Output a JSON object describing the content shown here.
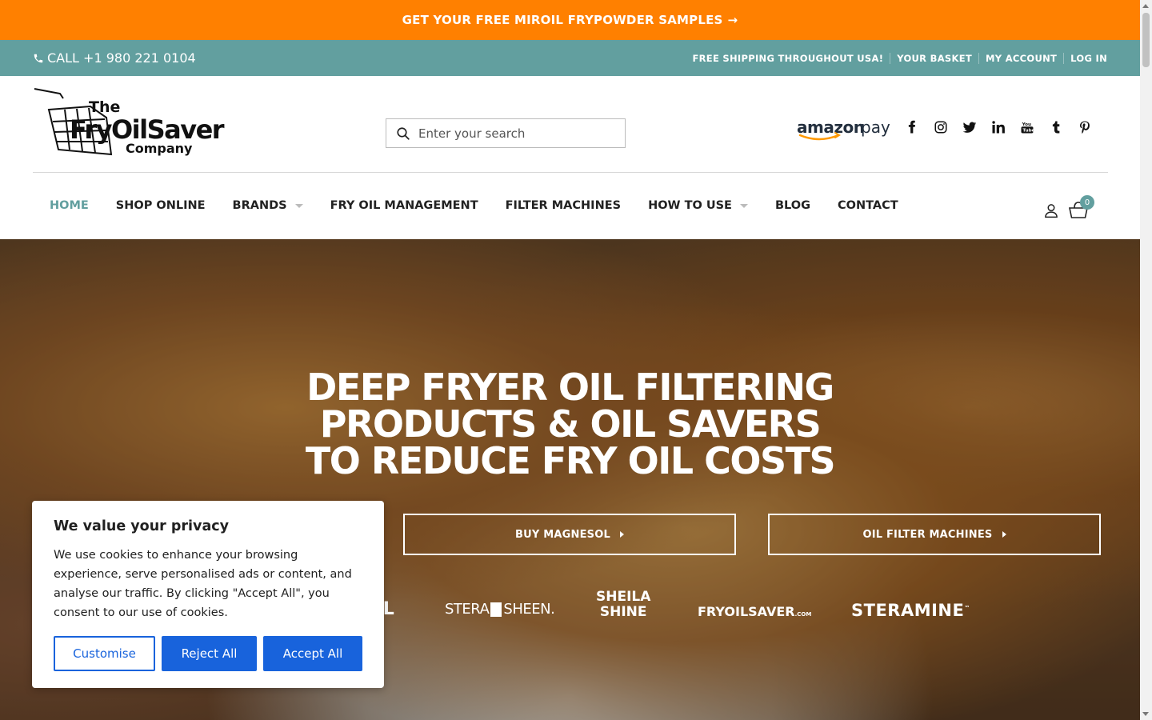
{
  "promo": {
    "text": "GET YOUR FREE MIROIL FRYPOWDER SAMPLES",
    "arrow": "→"
  },
  "topbar": {
    "phone": "CALL +1 980 221 0104",
    "links": [
      "FREE SHIPPING THROUGHOUT USA!",
      "YOUR BASKET",
      "MY ACCOUNT",
      "LOG IN"
    ]
  },
  "header": {
    "logo": {
      "line1": "The",
      "line2": "FryOilSaver",
      "line3": "Company"
    },
    "search_placeholder": "Enter your search",
    "payment": "amazon pay",
    "social_icons": [
      "facebook-icon",
      "instagram-icon",
      "twitter-icon",
      "linkedin-icon",
      "youtube-icon",
      "tumblr-icon",
      "pinterest-icon"
    ]
  },
  "nav": {
    "items": [
      {
        "label": "HOME",
        "active": true
      },
      {
        "label": "SHOP ONLINE"
      },
      {
        "label": "BRANDS",
        "dropdown": true
      },
      {
        "label": "FRY OIL MANAGEMENT"
      },
      {
        "label": "FILTER MACHINES"
      },
      {
        "label": "HOW TO USE",
        "dropdown": true
      },
      {
        "label": "BLOG"
      },
      {
        "label": "CONTACT"
      }
    ],
    "cart_count": "0"
  },
  "hero": {
    "title_lines": [
      "DEEP FRYER OIL FILTERING",
      "PRODUCTS & OIL SAVERS",
      "TO REDUCE FRY OIL COSTS"
    ],
    "buttons": [
      "BUY MAGNESOL",
      "OIL FILTER MACHINES"
    ],
    "brands": [
      "OL",
      "STERA",
      "SHEEN.",
      "SHEILA",
      "SHINE",
      "FRYOILSAVER",
      ".COM",
      "STERAMINE",
      "™"
    ]
  },
  "cookie": {
    "title": "We value your privacy",
    "text": "We use cookies to enhance your browsing experience, serve personalised ads or content, and analyse our traffic. By clicking \"Accept All\", you consent to our use of cookies.",
    "customise": "Customise",
    "reject": "Reject All",
    "accept": "Accept All"
  },
  "colors": {
    "promo": "#ff8000",
    "teal": "#629f9f",
    "cookie_blue": "#1863dc"
  }
}
